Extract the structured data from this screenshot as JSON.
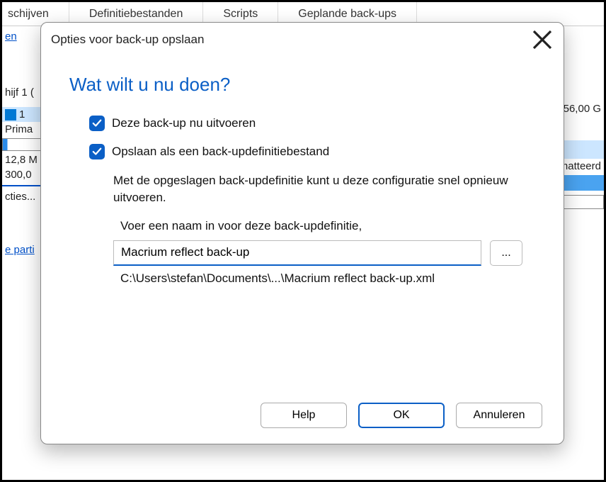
{
  "bg": {
    "tabs": [
      "schijven",
      "Definitiebestanden",
      "Scripts",
      "Geplande back-ups"
    ],
    "link_en": "en",
    "disk_label": "hijf 1 (",
    "row_1": "1",
    "row_prima": "Prima",
    "size1": "12,8 M",
    "size2": "300,0",
    "cties": "cties...",
    "e_parti": "e parti",
    "right_size": "56,00 G",
    "right_mat": "matteerd"
  },
  "dialog": {
    "title": "Opties voor back-up opslaan",
    "heading": "Wat wilt u nu doen?",
    "check1_label": "Deze back-up nu uitvoeren",
    "check2_label": "Opslaan als een back-updefinitiebestand",
    "explain": "Met de opgeslagen back-updefinitie kunt u deze configuratie snel opnieuw uitvoeren.",
    "prompt": "Voer een naam in voor deze back-updefinitie,",
    "input_value": "Macrium reflect back-up",
    "browse_label": "...",
    "path": "C:\\Users\\stefan\\Documents\\...\\Macrium reflect back-up.xml",
    "btn_help": "Help",
    "btn_ok": "OK",
    "btn_cancel": "Annuleren"
  }
}
